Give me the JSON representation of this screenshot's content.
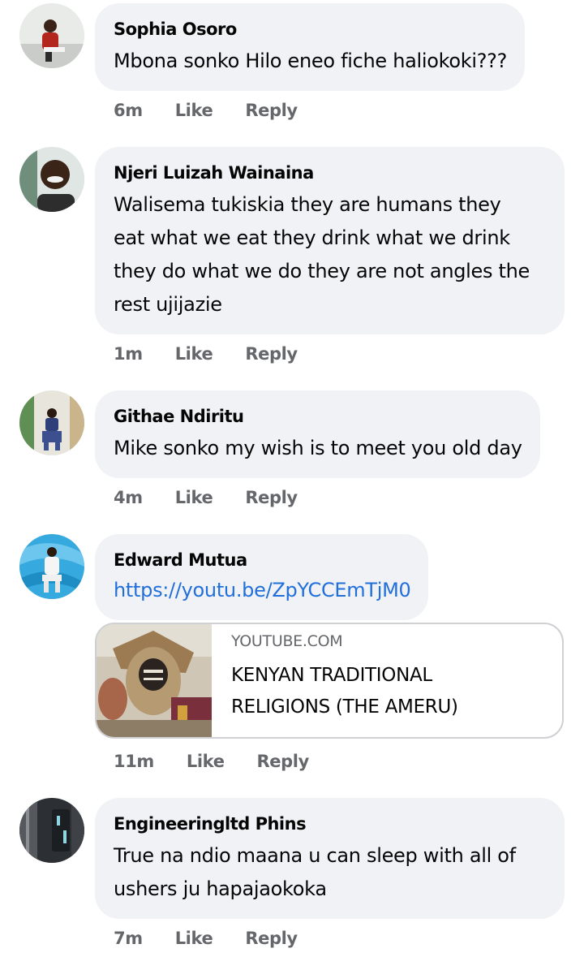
{
  "comments": [
    {
      "author": "Sophia Osoro",
      "text": "Mbona sonko Hilo eneo fiche haliokoki???",
      "time": "6m",
      "like_label": "Like",
      "reply_label": "Reply"
    },
    {
      "author": "Njeri Luizah Wainaina",
      "text_lines": [
        "Walisema tukiskia they are humans they",
        "eat what we eat they drink what we drink",
        "they do what we do they are not angles the",
        "rest ujijazie"
      ],
      "time": "1m",
      "like_label": "Like",
      "reply_label": "Reply"
    },
    {
      "author": "Githae Ndiritu",
      "text": "Mike sonko my wish is to meet you old day",
      "time": "4m",
      "like_label": "Like",
      "reply_label": "Reply"
    },
    {
      "author": "Edward Mutua",
      "link": "https://youtu.be/ZpYCCEmTjM0",
      "preview": {
        "domain": "YOUTUBE.COM",
        "title_lines": [
          "KENYAN TRADITIONAL",
          "RELIGIONS (THE AMERU)"
        ]
      },
      "time": "11m",
      "like_label": "Like",
      "reply_label": "Reply"
    },
    {
      "author": "Engineeringltd Phins",
      "text_lines": [
        "True na ndio maana u can sleep with all of",
        "ushers ju hapajaokoka"
      ],
      "time": "7m",
      "like_label": "Like",
      "reply_label": "Reply"
    }
  ],
  "colors": {
    "bubble_bg": "#f0f2f5",
    "meta_text": "#65676b",
    "link": "#216fdb",
    "card_border": "#ced0d4"
  }
}
